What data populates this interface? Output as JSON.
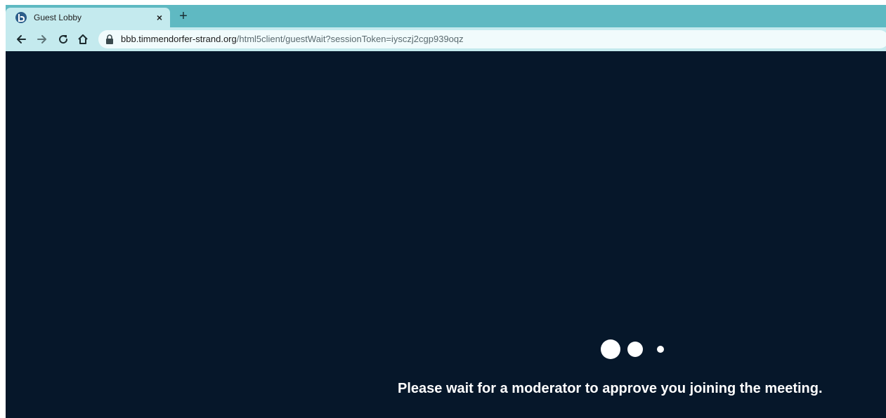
{
  "browser": {
    "tab": {
      "title": "Guest Lobby",
      "close_symbol": "×",
      "favicon_icon": "bigbluebutton-b-icon"
    },
    "new_tab_symbol": "+",
    "toolbar": {
      "back_icon": "arrow-left-icon",
      "forward_icon": "arrow-right-icon",
      "reload_icon": "reload-icon",
      "home_icon": "home-icon"
    },
    "address_bar": {
      "secure_icon": "lock-icon",
      "host": "bbb.timmendorfer-strand.org",
      "path": "/html5client/guestWait?sessionToken=iysczj2cgp939oqz"
    }
  },
  "page": {
    "background_color": "#06172a",
    "loader": {
      "dot_color": "#ffffff"
    },
    "message": "Please wait for a moderator to approve you joining the meeting."
  },
  "colors": {
    "tabstrip": "#5fb9c2",
    "toolbar": "#c4eaee",
    "omnibox": "#f1fbfc"
  }
}
